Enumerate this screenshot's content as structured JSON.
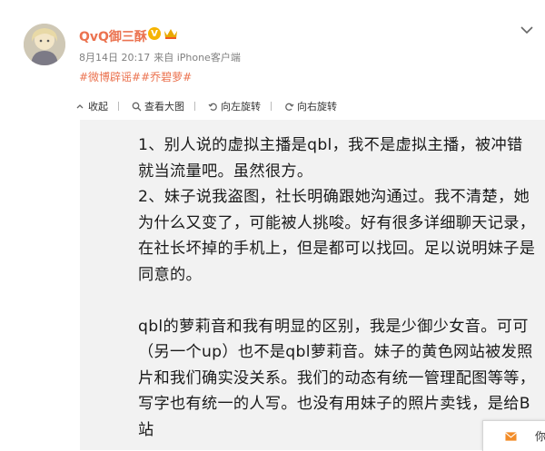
{
  "post": {
    "author_name": "QvQ御三酥",
    "verified_badge": "V",
    "time": "8月14日 20:17",
    "source": "来自 iPhone客户端",
    "tags": "#微博辟谣##乔碧萝#"
  },
  "toolbar": {
    "collapse": "收起",
    "view_full": "查看大图",
    "rotate_left": "向左旋转",
    "rotate_right": "向右旋转"
  },
  "image_text": {
    "paragraphs": [
      "1、别人说的虚拟主播是qbl，我不是虚拟主播，被冲错就当流量吧。虽然很方。",
      "2、妹子说我盗图，社长明确跟她沟通过。我不清楚，她为什么又变了，可能被人挑唆。好有很多详细聊天记录，在社长坏掉的手机上，但是都可以找回。足以说明妹子是同意的。",
      "qbl的萝莉音和我有明显的区别，我是少御少女音。可可（另一个up）也不是qbl萝莉音。妹子的黄色网站被发照片和我们确实没关系。我们的动态有统一管理配图等等，写字也有统一的人写。也没有用妹子的照片卖钱，是给B站"
    ]
  },
  "chat_popup": {
    "label": "你"
  },
  "colors": {
    "accent": "#eb7350",
    "meta": "#808080",
    "badge": "#f6b400"
  },
  "icons": [
    "more-chevron-icon",
    "collapse-icon",
    "zoom-icon",
    "rotate-left-icon",
    "rotate-right-icon",
    "mail-icon",
    "crown-icon"
  ]
}
